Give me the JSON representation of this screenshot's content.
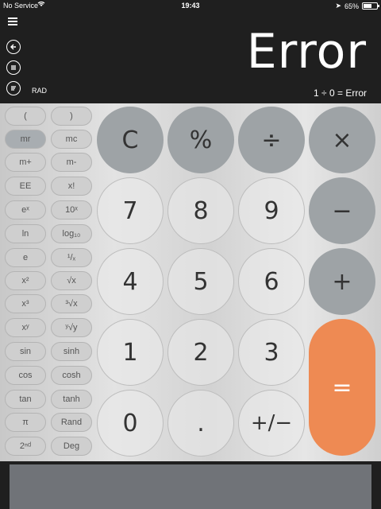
{
  "status_bar": {
    "carrier": "No Service",
    "time": "19:43",
    "battery": "65%",
    "battery_level": 0.65
  },
  "display": {
    "result": "Error",
    "expression": "1 ÷ 0 = Error",
    "angle_mode": "RAD"
  },
  "icons": {
    "menu": "menu-icon",
    "back": "back-arrow-icon",
    "list": "list-icon",
    "history": "history-icon"
  },
  "scientific_keys": [
    {
      "label": "(",
      "active": false
    },
    {
      "label": ")",
      "active": false
    },
    {
      "label": "mr",
      "active": true
    },
    {
      "label": "mc",
      "active": false
    },
    {
      "label": "m+",
      "active": false
    },
    {
      "label": "m-",
      "active": false
    },
    {
      "label": "EE",
      "active": false
    },
    {
      "label": "x!",
      "active": false
    },
    {
      "label": "eˣ",
      "active": false
    },
    {
      "label": "10ˣ",
      "active": false
    },
    {
      "label": "ln",
      "active": false
    },
    {
      "label": "log₁₀",
      "active": false
    },
    {
      "label": "e",
      "active": false
    },
    {
      "label": "¹/ₓ",
      "active": false
    },
    {
      "label": "x²",
      "active": false
    },
    {
      "label": "√x",
      "active": false
    },
    {
      "label": "x³",
      "active": false
    },
    {
      "label": "³√x",
      "active": false
    },
    {
      "label": "xʸ",
      "active": false
    },
    {
      "label": "ʸ√y",
      "active": false
    },
    {
      "label": "sin",
      "active": false
    },
    {
      "label": "sinh",
      "active": false
    },
    {
      "label": "cos",
      "active": false
    },
    {
      "label": "cosh",
      "active": false
    },
    {
      "label": "tan",
      "active": false
    },
    {
      "label": "tanh",
      "active": false
    },
    {
      "label": "π",
      "active": false
    },
    {
      "label": "Rand",
      "active": false
    },
    {
      "label": "2ⁿᵈ",
      "active": false
    },
    {
      "label": "Deg",
      "active": false
    }
  ],
  "main_keys": {
    "clear": "C",
    "percent": "%",
    "divide": "÷",
    "multiply": "×",
    "seven": "7",
    "eight": "8",
    "nine": "9",
    "minus": "−",
    "four": "4",
    "five": "5",
    "six": "6",
    "plus": "+",
    "one": "1",
    "two": "2",
    "three": "3",
    "equals": "=",
    "zero": "0",
    "decimal": ".",
    "sign": "+/−"
  },
  "colors": {
    "operator": "#9ea3a6",
    "equals": "#ee8a53",
    "background_dark": "#1f1f1f"
  }
}
